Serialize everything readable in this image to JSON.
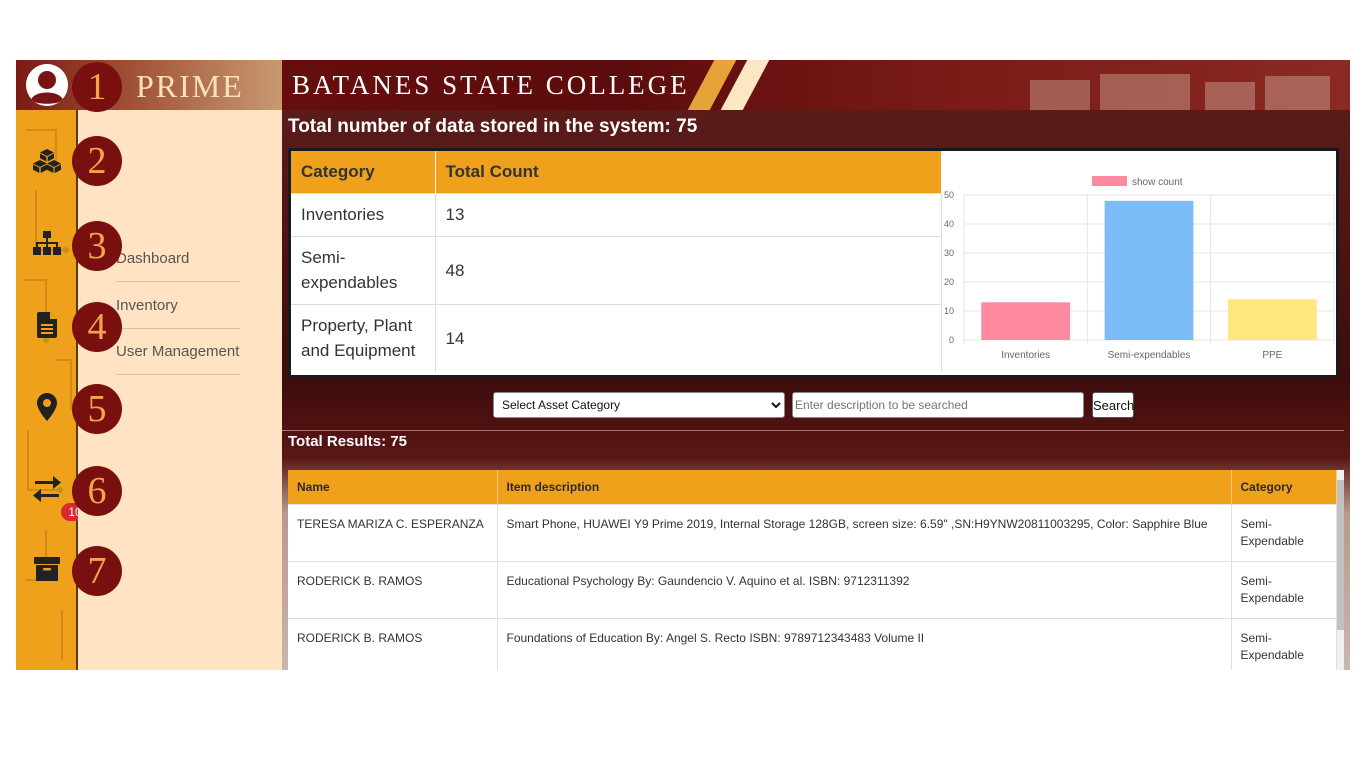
{
  "header": {
    "brand": "PRIME",
    "college": "BATANES STATE COLLEGE"
  },
  "rail": {
    "icons": [
      "avatar-icon",
      "cubes-icon",
      "sitemap-icon",
      "file-icon",
      "map-marker-icon",
      "exchange-icon",
      "archive-icon"
    ],
    "badge_count": "10"
  },
  "callouts": [
    "1",
    "2",
    "3",
    "4",
    "5",
    "6",
    "7"
  ],
  "submenu": {
    "items": [
      "Dashboard",
      "Inventory",
      "User Management"
    ]
  },
  "main": {
    "total_title": "Total number of data stored in the system: 75",
    "summary_table": {
      "headers": [
        "Category",
        "Total Count"
      ],
      "rows": [
        [
          "Inventories",
          "13"
        ],
        [
          "Semi-expendables",
          "48"
        ],
        [
          "Property, Plant and Equipment",
          "14"
        ]
      ]
    },
    "filters": {
      "select_value": "Select Asset Category",
      "search_placeholder": "Enter description to be searched",
      "search_label": "Search"
    },
    "results_label": "Total Results: 75",
    "results_table": {
      "headers": [
        "Name",
        "Item description",
        "Category"
      ],
      "rows": [
        [
          "TERESA MARIZA C. ESPERANZA",
          "Smart Phone, HUAWEI Y9 Prime 2019, Internal Storage 128GB, screen size: 6.59\" ,SN:H9YNW20811003295, Color: Sapphire Blue",
          "Semi-Expendable"
        ],
        [
          "RODERICK B. RAMOS",
          "Educational Psychology By: Gaundencio V. Aquino et al. ISBN: 9712311392",
          "Semi-Expendable"
        ],
        [
          "RODERICK B. RAMOS",
          "Foundations of Education By: Angel S. Recto ISBN: 9789712343483 Volume II",
          "Semi-Expendable"
        ],
        [
          "",
          "",
          ""
        ]
      ]
    }
  },
  "chart_data": {
    "type": "bar",
    "categories": [
      "Inventories",
      "Semi-expendables",
      "PPE"
    ],
    "series": [
      {
        "name": "show count",
        "values": [
          13,
          48,
          14
        ]
      }
    ],
    "colors": [
      "#ff8aa0",
      "#7dbdf7",
      "#ffe67f"
    ],
    "yticks": [
      0,
      10,
      20,
      30,
      40,
      50
    ],
    "ylim": [
      0,
      50
    ],
    "grid": true,
    "legend": "top"
  },
  "colors": {
    "accent": "#efa11b",
    "maroon": "#6e0f0f",
    "submenu_bg": "#ffe3c3",
    "badge": "#d9282f"
  }
}
